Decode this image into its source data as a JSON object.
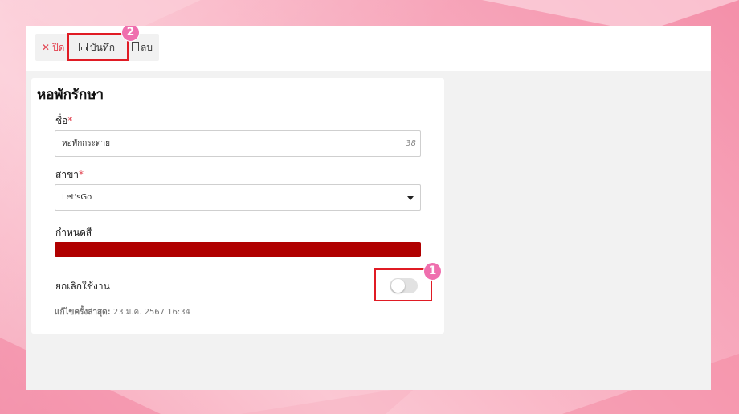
{
  "toolbar": {
    "close_label": "ปิด",
    "close_icon": "close-icon",
    "save_label": "บันทึก",
    "save_icon": "floppy-disk-icon",
    "delete_label": "ลบ",
    "delete_icon": "trash-icon"
  },
  "annotations": {
    "marker_1": "1",
    "marker_2": "2",
    "highlight_color": "#e01b24",
    "marker_color": "#ef6fae"
  },
  "form": {
    "title": "หอพักรักษา",
    "name": {
      "label": "ชื่อ",
      "required_mark": "*",
      "value": "หอพักกระต่าย",
      "counter": "38"
    },
    "branch": {
      "label": "สาขา",
      "required_mark": "*",
      "value": "Let'sGo"
    },
    "color": {
      "label": "กำหนดสี",
      "value": "#b00000"
    },
    "disable": {
      "label": "ยกเลิกใช้งาน",
      "enabled": false
    },
    "last_edit": {
      "label": "แก้ไขครั้งล่าสุด:",
      "value": "23 ม.ค. 2567 16:34"
    }
  }
}
